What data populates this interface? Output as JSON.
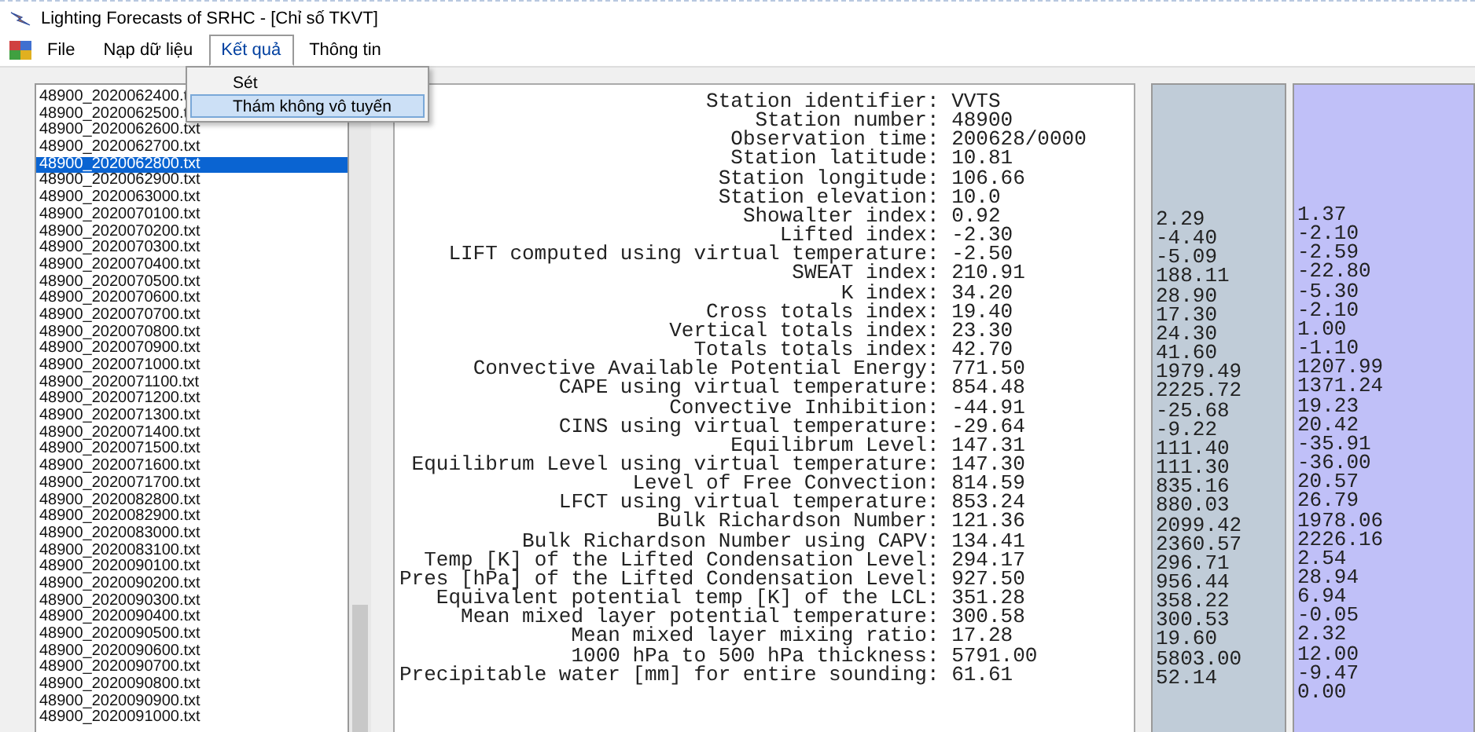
{
  "window": {
    "title": "Lighting Forecasts of SRHC - [Chỉ số TKVT]"
  },
  "menu": [
    {
      "label": "File",
      "selected": false
    },
    {
      "label": "Nạp dữ liệu",
      "selected": false
    },
    {
      "label": "Kết quả",
      "selected": true
    },
    {
      "label": "Thông tin",
      "selected": false
    }
  ],
  "dropdown": [
    {
      "label": "Sét",
      "selected": false
    },
    {
      "label": "Thám không vô tuyến",
      "selected": true
    }
  ],
  "files": [
    {
      "name": "48900_2020062400.t",
      "selected": false
    },
    {
      "name": "48900_2020062500.t",
      "selected": false
    },
    {
      "name": "48900_2020062600.txt",
      "selected": false
    },
    {
      "name": "48900_2020062700.txt",
      "selected": false
    },
    {
      "name": "48900_2020062800.txt",
      "selected": true
    },
    {
      "name": "48900_2020062900.txt",
      "selected": false
    },
    {
      "name": "48900_2020063000.txt",
      "selected": false
    },
    {
      "name": "48900_2020070100.txt",
      "selected": false
    },
    {
      "name": "48900_2020070200.txt",
      "selected": false
    },
    {
      "name": "48900_2020070300.txt",
      "selected": false
    },
    {
      "name": "48900_2020070400.txt",
      "selected": false
    },
    {
      "name": "48900_2020070500.txt",
      "selected": false
    },
    {
      "name": "48900_2020070600.txt",
      "selected": false
    },
    {
      "name": "48900_2020070700.txt",
      "selected": false
    },
    {
      "name": "48900_2020070800.txt",
      "selected": false
    },
    {
      "name": "48900_2020070900.txt",
      "selected": false
    },
    {
      "name": "48900_2020071000.txt",
      "selected": false
    },
    {
      "name": "48900_2020071100.txt",
      "selected": false
    },
    {
      "name": "48900_2020071200.txt",
      "selected": false
    },
    {
      "name": "48900_2020071300.txt",
      "selected": false
    },
    {
      "name": "48900_2020071400.txt",
      "selected": false
    },
    {
      "name": "48900_2020071500.txt",
      "selected": false
    },
    {
      "name": "48900_2020071600.txt",
      "selected": false
    },
    {
      "name": "48900_2020071700.txt",
      "selected": false
    },
    {
      "name": "48900_2020082800.txt",
      "selected": false
    },
    {
      "name": "48900_2020082900.txt",
      "selected": false
    },
    {
      "name": "48900_2020083000.txt",
      "selected": false
    },
    {
      "name": "48900_2020083100.txt",
      "selected": false
    },
    {
      "name": "48900_2020090100.txt",
      "selected": false
    },
    {
      "name": "48900_2020090200.txt",
      "selected": false
    },
    {
      "name": "48900_2020090300.txt",
      "selected": false
    },
    {
      "name": "48900_2020090400.txt",
      "selected": false
    },
    {
      "name": "48900_2020090500.txt",
      "selected": false
    },
    {
      "name": "48900_2020090600.txt",
      "selected": false
    },
    {
      "name": "48900_2020090700.txt",
      "selected": false
    },
    {
      "name": "48900_2020090800.txt",
      "selected": false
    },
    {
      "name": "48900_2020090900.txt",
      "selected": false
    },
    {
      "name": "48900_2020091000.txt",
      "selected": false
    }
  ],
  "results": [
    {
      "label": "Station identifier:",
      "value": "VVTS"
    },
    {
      "label": "Station number:",
      "value": "48900"
    },
    {
      "label": "Observation time:",
      "value": "200628/0000"
    },
    {
      "label": "Station latitude:",
      "value": "10.81"
    },
    {
      "label": "Station longitude:",
      "value": "106.66"
    },
    {
      "label": "Station elevation:",
      "value": "10.0"
    },
    {
      "label": "Showalter index:",
      "value": "0.92"
    },
    {
      "label": "Lifted index:",
      "value": "-2.30"
    },
    {
      "label": "LIFT computed using virtual temperature:",
      "value": "-2.50"
    },
    {
      "label": "SWEAT index:",
      "value": "210.91"
    },
    {
      "label": "K index:",
      "value": "34.20"
    },
    {
      "label": "Cross totals index:",
      "value": "19.40"
    },
    {
      "label": "Vertical totals index:",
      "value": "23.30"
    },
    {
      "label": "Totals totals index:",
      "value": "42.70"
    },
    {
      "label": "Convective Available Potential Energy:",
      "value": "771.50"
    },
    {
      "label": "CAPE using virtual temperature:",
      "value": "854.48"
    },
    {
      "label": "Convective Inhibition:",
      "value": "-44.91"
    },
    {
      "label": "CINS using virtual temperature:",
      "value": "-29.64"
    },
    {
      "label": "Equilibrum Level:",
      "value": "147.31"
    },
    {
      "label": "Equilibrum Level using virtual temperature:",
      "value": "147.30"
    },
    {
      "label": "Level of Free Convection:",
      "value": "814.59"
    },
    {
      "label": "LFCT using virtual temperature:",
      "value": "853.24"
    },
    {
      "label": "Bulk Richardson Number:",
      "value": "121.36"
    },
    {
      "label": "Bulk Richardson Number using CAPV:",
      "value": "134.41"
    },
    {
      "label": "Temp [K] of the Lifted Condensation Level:",
      "value": "294.17"
    },
    {
      "label": "Pres [hPa] of the Lifted Condensation Level:",
      "value": "927.50"
    },
    {
      "label": "Equivalent potential temp [K] of the LCL:",
      "value": "351.28"
    },
    {
      "label": "Mean mixed layer potential temperature:",
      "value": "300.58"
    },
    {
      "label": "Mean mixed layer mixing ratio:",
      "value": "17.28"
    },
    {
      "label": "1000 hPa to 500 hPa thickness:",
      "value": "5791.00"
    },
    {
      "label": "Precipitable water [mm] for entire sounding:",
      "value": "61.61"
    }
  ],
  "column_2": [
    "2.29",
    "-4.40",
    "-5.09",
    "188.11",
    "28.90",
    "17.30",
    "24.30",
    "41.60",
    "1979.49",
    "2225.72",
    "-25.68",
    "-9.22",
    "111.40",
    "111.30",
    "835.16",
    "880.03",
    "2099.42",
    "2360.57",
    "296.71",
    "956.44",
    "358.22",
    "300.53",
    "19.60",
    "5803.00",
    "52.14"
  ],
  "column_3": [
    "1.37",
    "-2.10",
    "-2.59",
    "-22.80",
    "-5.30",
    "-2.10",
    "1.00",
    "-1.10",
    "1207.99",
    "1371.24",
    "19.23",
    "20.42",
    "-35.91",
    "-36.00",
    "20.57",
    "26.79",
    "1978.06",
    "2226.16",
    "2.54",
    "28.94",
    "6.94",
    "-0.05",
    "2.32",
    "12.00",
    "-9.47",
    "0.00"
  ]
}
